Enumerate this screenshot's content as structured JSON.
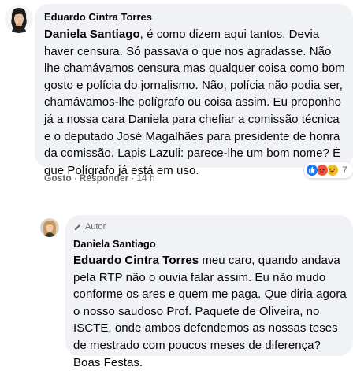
{
  "comment1": {
    "author": "Eduardo Cintra Torres",
    "mention": "Daniela Santiago",
    "text": ", é como dizem aqui tantos. Devia haver censura. Só passava o que nos agradasse. Não lhe chamávamos censura mas qualquer coisa como bom gosto e polícia do jornalismo. Não, polícia não podia ser, chamávamos-lhe polígrafo ou coisa assim. Eu proponho já a nossa cara Daniela para chefiar a comissão técnica e o deputado José Magalhães para presidente de honra da comissão. Lapis Lazuli: parece-lhe um bom nome? É que Polígrafo já está em uso.",
    "like_label": "Gosto",
    "reply_label": "Responder",
    "separator": "·",
    "time": "14 h",
    "reaction_count": "7",
    "reactions": [
      "like-icon",
      "angry-icon",
      "haha-icon"
    ]
  },
  "comment2": {
    "badge_label": "Autor",
    "author": "Daniela Santiago",
    "mention": "Eduardo Cintra Torres",
    "text": " meu caro, quando andava pela RTP não o ouvia falar assim. Eu não mudo conforme os ares e quem me paga. Que diria agora o nosso saudoso Prof. Paquete de Oliveira, no ISCTE, onde ambos defendemos as nossas teses de mestrado com poucos meses de diferença? Boas Festas."
  },
  "colors": {
    "bubble": "#f0f2f5",
    "secondary_text": "#65676b",
    "like_blue": "#1877f2",
    "angry_orange": "#f0553c",
    "haha_yellow": "#f7b928"
  }
}
